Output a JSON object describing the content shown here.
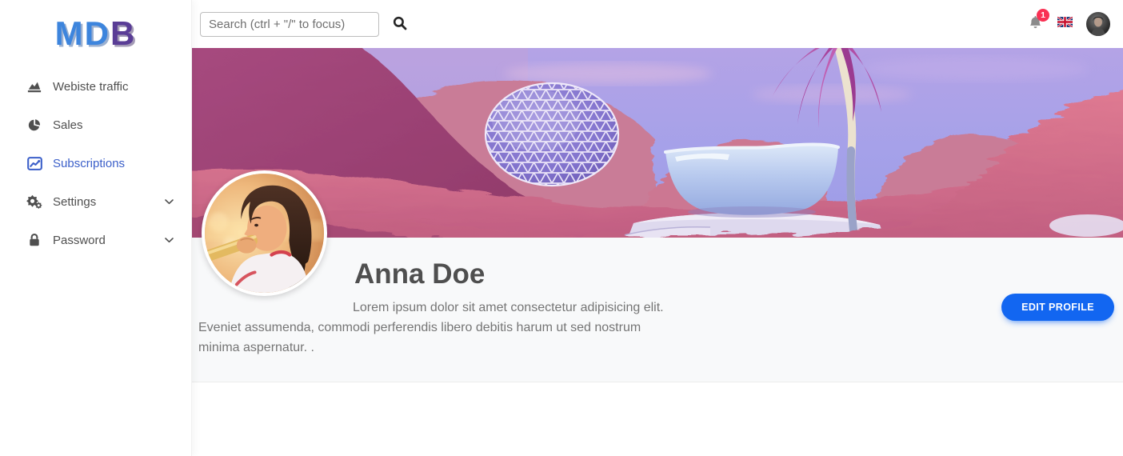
{
  "brand": {
    "name": "MDB",
    "logo_md": "MD",
    "logo_b": "B"
  },
  "topbar": {
    "search_placeholder": "Search (ctrl + \"/\" to focus)",
    "notification_count": "1"
  },
  "sidebar": {
    "items": [
      {
        "label": "Webiste traffic",
        "icon": "chart-area-icon",
        "active": false,
        "expandable": false
      },
      {
        "label": "Sales",
        "icon": "chart-pie-icon",
        "active": false,
        "expandable": false
      },
      {
        "label": "Subscriptions",
        "icon": "chart-line-icon",
        "active": true,
        "expandable": false
      },
      {
        "label": "Settings",
        "icon": "gears-icon",
        "active": false,
        "expandable": true
      },
      {
        "label": "Password",
        "icon": "lock-icon",
        "active": false,
        "expandable": true
      }
    ]
  },
  "profile": {
    "name": "Anna Doe",
    "bio": "Lorem ipsum dolor sit amet consectetur adipisicing elit. Eveniet assumenda, commodi perferendis libero debitis harum ut sed nostrum minima aspernatur. .",
    "edit_button_label": "EDIT PROFILE"
  },
  "colors": {
    "primary_button": "#1266f1",
    "sidebar_active": "#3b5fc9",
    "badge_danger": "#f93154",
    "logo_blue": "#3d85dd",
    "logo_purple": "#5a3d96",
    "profile_section_bg": "#f8f9fa",
    "text_muted": "#757575",
    "text_main": "#4f4f4f"
  }
}
